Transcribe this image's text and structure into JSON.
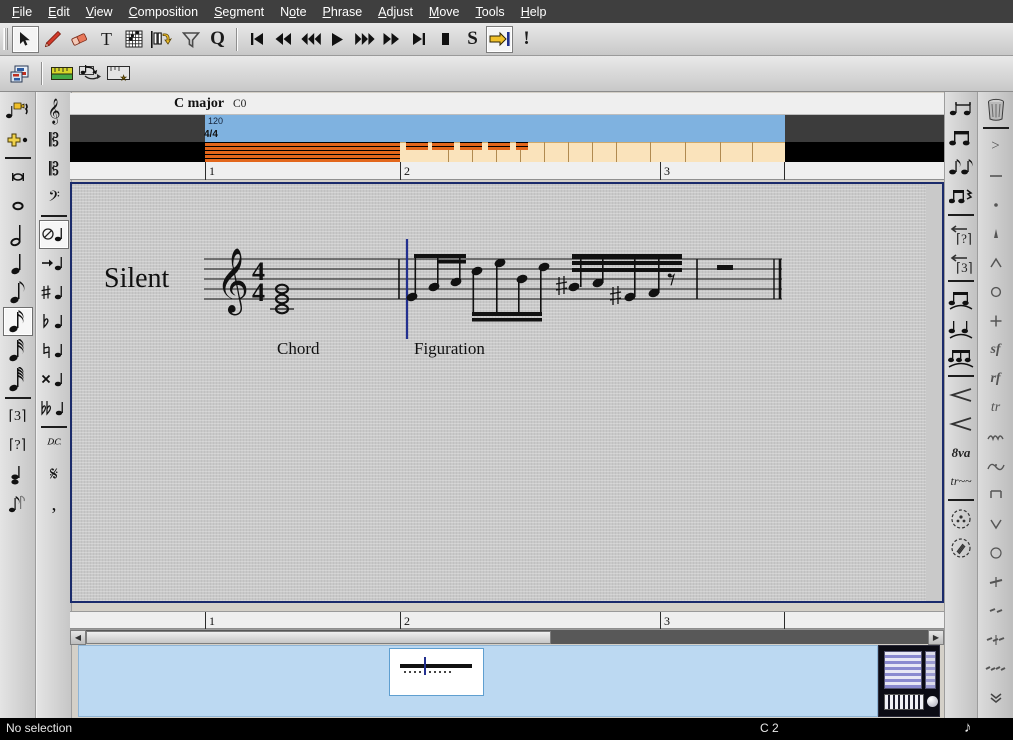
{
  "window": {
    "app": "Rosegarden Notation Editor"
  },
  "menubar": {
    "items": [
      {
        "label": "File",
        "accel": "F"
      },
      {
        "label": "Edit",
        "accel": "E"
      },
      {
        "label": "View",
        "accel": "V"
      },
      {
        "label": "Composition",
        "accel": "C"
      },
      {
        "label": "Segment",
        "accel": "S"
      },
      {
        "label": "Note",
        "accel": "o"
      },
      {
        "label": "Phrase",
        "accel": "P"
      },
      {
        "label": "Adjust",
        "accel": "A"
      },
      {
        "label": "Move",
        "accel": "M"
      },
      {
        "label": "Tools",
        "accel": "T"
      },
      {
        "label": "Help",
        "accel": "H"
      }
    ]
  },
  "toolbar_main": {
    "tools": [
      {
        "name": "select-tool",
        "icon": "arrow-cursor-icon",
        "active": true
      },
      {
        "name": "draw-tool",
        "icon": "pencil-icon",
        "active": false
      },
      {
        "name": "erase-tool",
        "icon": "eraser-icon",
        "active": false
      },
      {
        "name": "text-tool",
        "icon": "text-T-icon",
        "active": false
      },
      {
        "name": "guitar-chord-tool",
        "icon": "fretboard-icon",
        "active": false
      },
      {
        "name": "insert-note-tool",
        "icon": "note-insert-icon",
        "active": false
      },
      {
        "name": "filter-tool",
        "icon": "funnel-icon",
        "active": false
      },
      {
        "name": "quantize-tool",
        "icon": "quantize-Q-icon",
        "active": false
      }
    ],
    "transport": [
      {
        "name": "rewind-to-beginning",
        "icon": "skip-start-icon"
      },
      {
        "name": "rewind",
        "icon": "rewind-icon"
      },
      {
        "name": "rewind-fast",
        "icon": "rewind-fast-icon"
      },
      {
        "name": "play",
        "icon": "play-icon"
      },
      {
        "name": "fast-forward-fast",
        "icon": "forward-fast-icon"
      },
      {
        "name": "fast-forward",
        "icon": "forward-icon"
      },
      {
        "name": "forward-to-end",
        "icon": "skip-end-icon"
      },
      {
        "name": "stop",
        "icon": "stop-icon"
      },
      {
        "name": "solo",
        "icon": "solo-S-icon"
      },
      {
        "name": "jump-to-playback-pointer",
        "icon": "arrow-to-bar-icon",
        "active": true
      },
      {
        "name": "panic",
        "icon": "panic-exclaim-icon"
      }
    ]
  },
  "toolbar_secondary": {
    "buttons": [
      {
        "name": "open-in-matrix-editor",
        "icon": "matrix-editor-icon"
      },
      {
        "name": "show-rulers",
        "icon": "ruler-icon"
      },
      {
        "name": "show-annotations",
        "icon": "note-ruler-icon"
      },
      {
        "name": "show-lilypond-markers",
        "icon": "ruler-star-icon"
      }
    ]
  },
  "left_toolbar_1": {
    "buttons": [
      {
        "name": "rest-insert",
        "icon": "rest-arrow-icon"
      },
      {
        "name": "add-dot",
        "icon": "dot-plus-icon"
      },
      {
        "name": "duration-bar",
        "icon": "duration-bar-icon"
      },
      {
        "name": "breve-note",
        "icon": "breve-icon"
      },
      {
        "name": "whole-note",
        "icon": "whole-note-icon"
      },
      {
        "name": "half-note",
        "icon": "half-note-icon"
      },
      {
        "name": "quarter-note",
        "icon": "quarter-note-icon"
      },
      {
        "name": "eighth-note",
        "icon": "eighth-note-icon"
      },
      {
        "name": "sixteenth-note",
        "icon": "sixteenth-note-icon",
        "active": true
      },
      {
        "name": "thirtysecond-note",
        "icon": "thirtysecond-note-icon"
      },
      {
        "name": "sixtyfourth-note",
        "icon": "sixtyfourth-note-icon"
      },
      {
        "name": "triplet-mode",
        "icon": "triplet-3-icon"
      },
      {
        "name": "tuplet-mode",
        "icon": "tuplet-question-icon"
      },
      {
        "name": "chord-mode",
        "icon": "chord-stack-icon"
      },
      {
        "name": "grace-note-mode",
        "icon": "grace-note-icon"
      }
    ]
  },
  "left_toolbar_2": {
    "buttons": [
      {
        "name": "treble-clef",
        "icon": "treble-clef-icon"
      },
      {
        "name": "alto-clef",
        "icon": "alto-clef-icon"
      },
      {
        "name": "tenor-clef",
        "icon": "tenor-clef-icon"
      },
      {
        "name": "bass-clef",
        "icon": "bass-clef-icon"
      },
      {
        "name": "no-accidental",
        "icon": "no-accidental-icon",
        "active": true
      },
      {
        "name": "follow-previous-accidental",
        "icon": "accidental-arrow-icon"
      },
      {
        "name": "sharp",
        "icon": "sharp-icon"
      },
      {
        "name": "flat",
        "icon": "flat-icon"
      },
      {
        "name": "natural",
        "icon": "natural-icon"
      },
      {
        "name": "double-sharp",
        "icon": "double-sharp-icon"
      },
      {
        "name": "double-flat",
        "icon": "double-flat-icon"
      },
      {
        "name": "segno",
        "icon": "segno-icon"
      },
      {
        "name": "coda",
        "icon": "coda-icon"
      },
      {
        "name": "breath-mark",
        "icon": "breath-mark-icon"
      }
    ]
  },
  "right_toolbar_1": {
    "buttons": [
      {
        "name": "tie-notes",
        "icon": "tie-notes-icon"
      },
      {
        "name": "beam-group",
        "icon": "beam-group-icon"
      },
      {
        "name": "unbeam",
        "icon": "unbeam-icon"
      },
      {
        "name": "auto-beam",
        "icon": "auto-beam-icon"
      },
      {
        "name": "untuplet",
        "icon": "untuplet-question-icon"
      },
      {
        "name": "untriplet",
        "icon": "untriplet-3-icon"
      },
      {
        "name": "slur-above",
        "icon": "slur-above-icon"
      },
      {
        "name": "slur-below",
        "icon": "slur-below-icon"
      },
      {
        "name": "phrasing-slur",
        "icon": "phrasing-slur-icon"
      },
      {
        "name": "crescendo",
        "icon": "crescendo-icon"
      },
      {
        "name": "decrescendo",
        "icon": "decrescendo-icon"
      },
      {
        "name": "ottava",
        "icon": "ottava-8va-icon"
      },
      {
        "name": "trill-line",
        "icon": "trill-line-icon"
      },
      {
        "name": "pedal-down",
        "icon": "pedal-down-icon"
      },
      {
        "name": "pedal-up",
        "icon": "pedal-up-icon"
      }
    ]
  },
  "right_toolbar_2": {
    "buttons": [
      {
        "name": "delete-marks",
        "icon": "trash-icon"
      },
      {
        "name": "accent-mark",
        "icon": "accent-icon"
      },
      {
        "name": "tenuto-mark",
        "icon": "tenuto-icon"
      },
      {
        "name": "staccato-mark",
        "icon": "staccato-icon"
      },
      {
        "name": "staccatissimo-mark",
        "icon": "staccatissimo-icon"
      },
      {
        "name": "marcato-mark",
        "icon": "marcato-icon"
      },
      {
        "name": "open-mark",
        "icon": "open-circle-icon"
      },
      {
        "name": "stopped-mark",
        "icon": "stopped-plus-icon"
      },
      {
        "name": "sforzando-mark",
        "icon": "sforzando-sf-icon"
      },
      {
        "name": "rinforzando-mark",
        "icon": "rinforzando-rf-icon"
      },
      {
        "name": "trill-mark",
        "icon": "trill-tr-icon"
      },
      {
        "name": "mordent-mark",
        "icon": "mordent-icon"
      },
      {
        "name": "turn-mark",
        "icon": "turn-icon"
      },
      {
        "name": "down-bow-mark",
        "icon": "down-bow-icon"
      },
      {
        "name": "up-bow-mark",
        "icon": "up-bow-icon"
      },
      {
        "name": "harmonic-mark",
        "icon": "harmonic-circle-icon"
      },
      {
        "name": "tremolo-1",
        "icon": "tremolo-one-icon"
      },
      {
        "name": "tremolo-2",
        "icon": "tremolo-two-icon"
      },
      {
        "name": "tremolo-3",
        "icon": "tremolo-three-icon"
      },
      {
        "name": "tremolo-4",
        "icon": "tremolo-four-icon"
      },
      {
        "name": "chevron-down",
        "icon": "chevron-down-icon"
      }
    ]
  },
  "header": {
    "chord_name": "C major",
    "octave": "C0"
  },
  "rulers": {
    "tempo": "120",
    "time_signature": "4/4",
    "bar_numbers": [
      "1",
      "2",
      "3"
    ]
  },
  "notation": {
    "track_label": "Silent",
    "clef": "treble",
    "time_signature_top": "4",
    "time_signature_bottom": "4",
    "segment_labels": [
      "Chord",
      "Figuration"
    ]
  },
  "statusbar": {
    "selection": "No selection",
    "pitch": "C 2",
    "duration_icon": "eighth-note-icon"
  },
  "colors": {
    "menubar_bg": "#3f3f3f",
    "toolbar_bg": "#d8d8d8",
    "segment_orange": "#e2661b",
    "segment_tail": "#fae3bb",
    "ruler_blue": "#7fb2e0",
    "canvas_bg": "#c9c9c9",
    "playhead": "#23308f",
    "panner_bg": "#bcd9f2",
    "frame_border": "#1b2b6b",
    "statusbar_bg": "#000000"
  }
}
